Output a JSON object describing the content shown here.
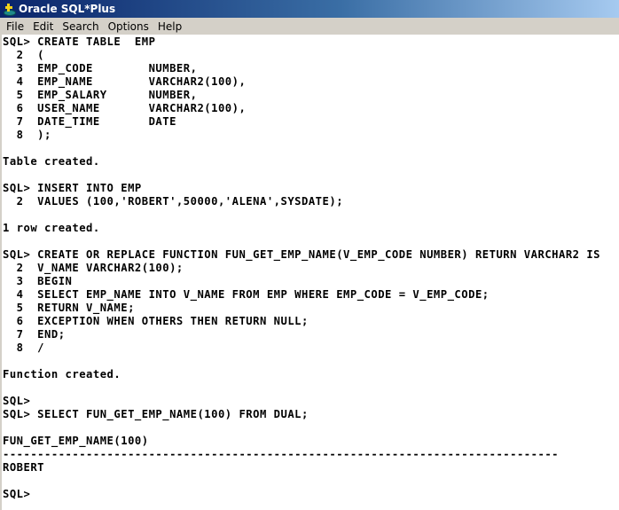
{
  "window": {
    "title": "Oracle SQL*Plus",
    "icon": "oracle-sqlplus-icon"
  },
  "menu": {
    "items": [
      "File",
      "Edit",
      "Search",
      "Options",
      "Help"
    ]
  },
  "console": {
    "lines": [
      "SQL> CREATE TABLE  EMP",
      "  2  (",
      "  3  EMP_CODE        NUMBER,",
      "  4  EMP_NAME        VARCHAR2(100),",
      "  5  EMP_SALARY      NUMBER,",
      "  6  USER_NAME       VARCHAR2(100),",
      "  7  DATE_TIME       DATE",
      "  8  );",
      "",
      "Table created.",
      "",
      "SQL> INSERT INTO EMP",
      "  2  VALUES (100,'ROBERT',50000,'ALENA',SYSDATE);",
      "",
      "1 row created.",
      "",
      "SQL> CREATE OR REPLACE FUNCTION FUN_GET_EMP_NAME(V_EMP_CODE NUMBER) RETURN VARCHAR2 IS",
      "  2  V_NAME VARCHAR2(100);",
      "  3  BEGIN",
      "  4  SELECT EMP_NAME INTO V_NAME FROM EMP WHERE EMP_CODE = V_EMP_CODE;",
      "  5  RETURN V_NAME;",
      "  6  EXCEPTION WHEN OTHERS THEN RETURN NULL;",
      "  7  END;",
      "  8  /",
      "",
      "Function created.",
      "",
      "SQL>",
      "SQL> SELECT FUN_GET_EMP_NAME(100) FROM DUAL;",
      "",
      "FUN_GET_EMP_NAME(100)",
      "--------------------------------------------------------------------------------",
      "ROBERT",
      "",
      "SQL>"
    ]
  }
}
